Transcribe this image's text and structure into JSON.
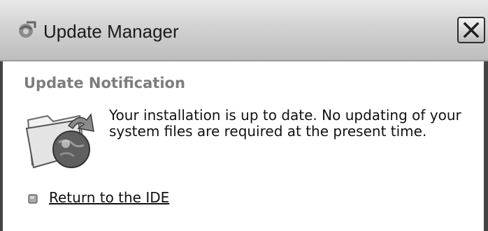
{
  "window": {
    "title": "Update Manager",
    "close_glyph": "×"
  },
  "content": {
    "heading": "Update Notification",
    "message": "Your installation is up to date. No updating of your system files are required at the present time.",
    "return_link": "Return to the IDE"
  },
  "icons": {
    "app": "update-manager-icon",
    "folder": "folder-globe-icon",
    "bullet": "bullet-square-icon",
    "close": "close-icon"
  },
  "colors": {
    "heading": "#7d7d7d",
    "text": "#111111",
    "titlebar": "#cfcfcf"
  }
}
